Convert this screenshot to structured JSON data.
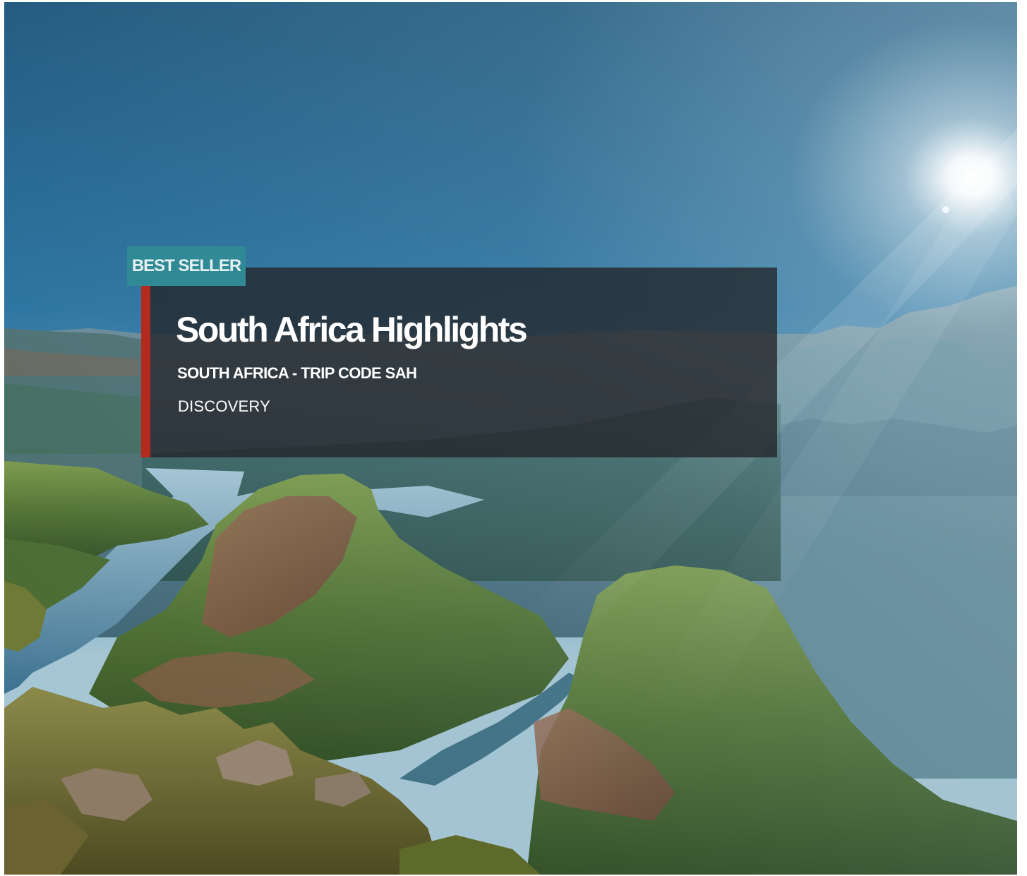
{
  "tour_card": {
    "badge": "BEST SELLER",
    "title": "South Africa Highlights",
    "subtitle": "SOUTH AFRICA - TRIP CODE SAH",
    "style": "DISCOVERY"
  },
  "hero_image": {
    "subject": "Blyde River Canyon landscape"
  },
  "colors": {
    "badge_bg": "#2f8a95",
    "accent_bar": "#b42a1e",
    "panel_bg": "#222428"
  }
}
